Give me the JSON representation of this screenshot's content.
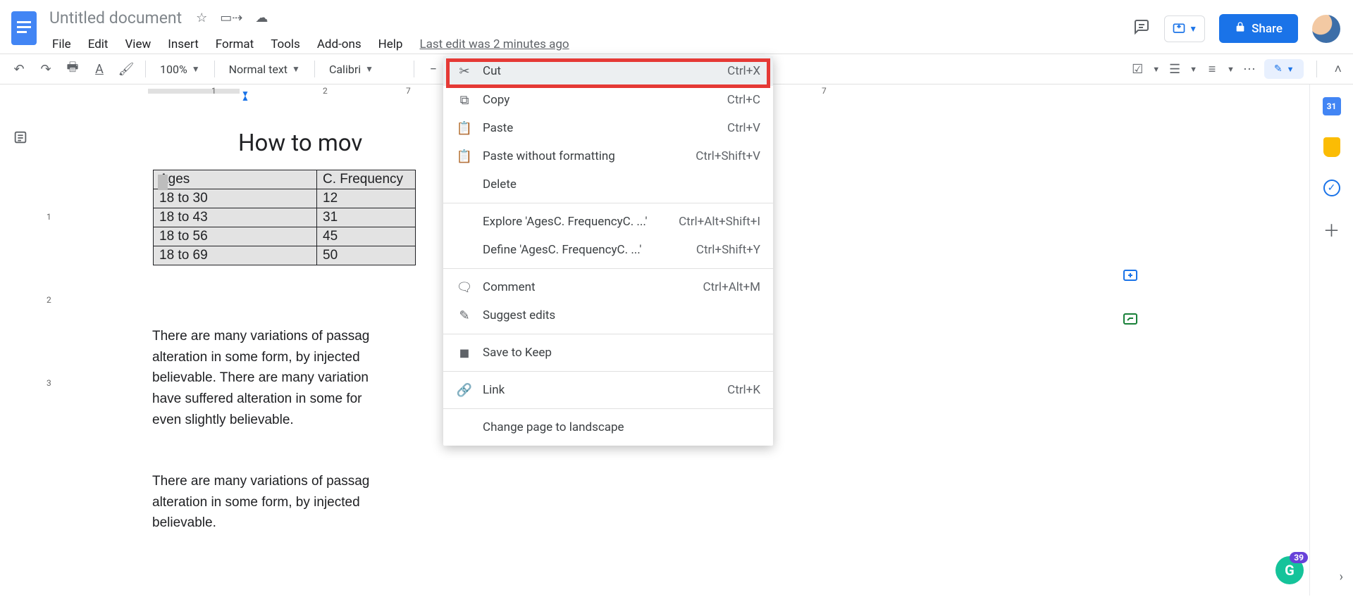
{
  "header": {
    "doc_title": "Untitled document",
    "star_tooltip": "Star",
    "move_tooltip": "Move",
    "cloud_tooltip": "See document status",
    "menus": [
      "File",
      "Edit",
      "View",
      "Insert",
      "Format",
      "Tools",
      "Add-ons",
      "Help"
    ],
    "last_edit": "Last edit was 2 minutes ago",
    "share_label": "Share"
  },
  "toolbar": {
    "zoom": "100%",
    "style": "Normal text",
    "font": "Calibri",
    "checklist_tip": "Checklist",
    "bullets_tip": "Bulleted list",
    "numbers_tip": "Numbered list",
    "more_tip": "More",
    "mode": "Editing"
  },
  "ruler": {
    "hticks": [
      "1",
      "2",
      "7"
    ],
    "vticks": [
      "1",
      "2",
      "3"
    ]
  },
  "document": {
    "heading": "How to mov",
    "table": {
      "headers": [
        "Ages",
        "C. Frequency"
      ],
      "rows": [
        [
          "18 to 30",
          "12"
        ],
        [
          "18 to 43",
          "31"
        ],
        [
          "18 to 56",
          "45"
        ],
        [
          "18 to 69",
          "50"
        ]
      ]
    },
    "para1_lines": [
      "There are many variations of passag",
      "alteration in some form, by injected",
      "believable. There are many variation",
      "have suffered alteration in some for",
      "even slightly believable."
    ],
    "para2_lines": [
      "There are many variations of passag",
      "alteration in some form, by injected",
      "believable."
    ]
  },
  "context_menu": {
    "items": [
      {
        "icon": "cut-icon",
        "label": "Cut",
        "shortcut": "Ctrl+X",
        "highlight": true
      },
      {
        "icon": "copy-icon",
        "label": "Copy",
        "shortcut": "Ctrl+C"
      },
      {
        "icon": "paste-icon",
        "label": "Paste",
        "shortcut": "Ctrl+V"
      },
      {
        "icon": "paste-plain-icon",
        "label": "Paste without formatting",
        "shortcut": "Ctrl+Shift+V"
      },
      {
        "icon": "",
        "label": "Delete",
        "shortcut": ""
      },
      {
        "sep": true
      },
      {
        "icon": "",
        "label": "Explore 'AgesC. FrequencyC. ...'",
        "shortcut": "Ctrl+Alt+Shift+I"
      },
      {
        "icon": "",
        "label": "Define 'AgesC. FrequencyC. ...'",
        "shortcut": "Ctrl+Shift+Y"
      },
      {
        "sep": true
      },
      {
        "icon": "comment-icon",
        "label": "Comment",
        "shortcut": "Ctrl+Alt+M"
      },
      {
        "icon": "suggest-icon",
        "label": "Suggest edits",
        "shortcut": ""
      },
      {
        "sep": true
      },
      {
        "icon": "keep-icon",
        "label": "Save to Keep",
        "shortcut": ""
      },
      {
        "sep": true
      },
      {
        "icon": "link-icon",
        "label": "Link",
        "shortcut": "Ctrl+K"
      },
      {
        "sep": true
      },
      {
        "icon": "",
        "label": "Change page to landscape",
        "shortcut": ""
      }
    ]
  },
  "right_rail": {
    "calendar_day": "31"
  },
  "grammarly": {
    "count": "39",
    "letter": "G"
  }
}
